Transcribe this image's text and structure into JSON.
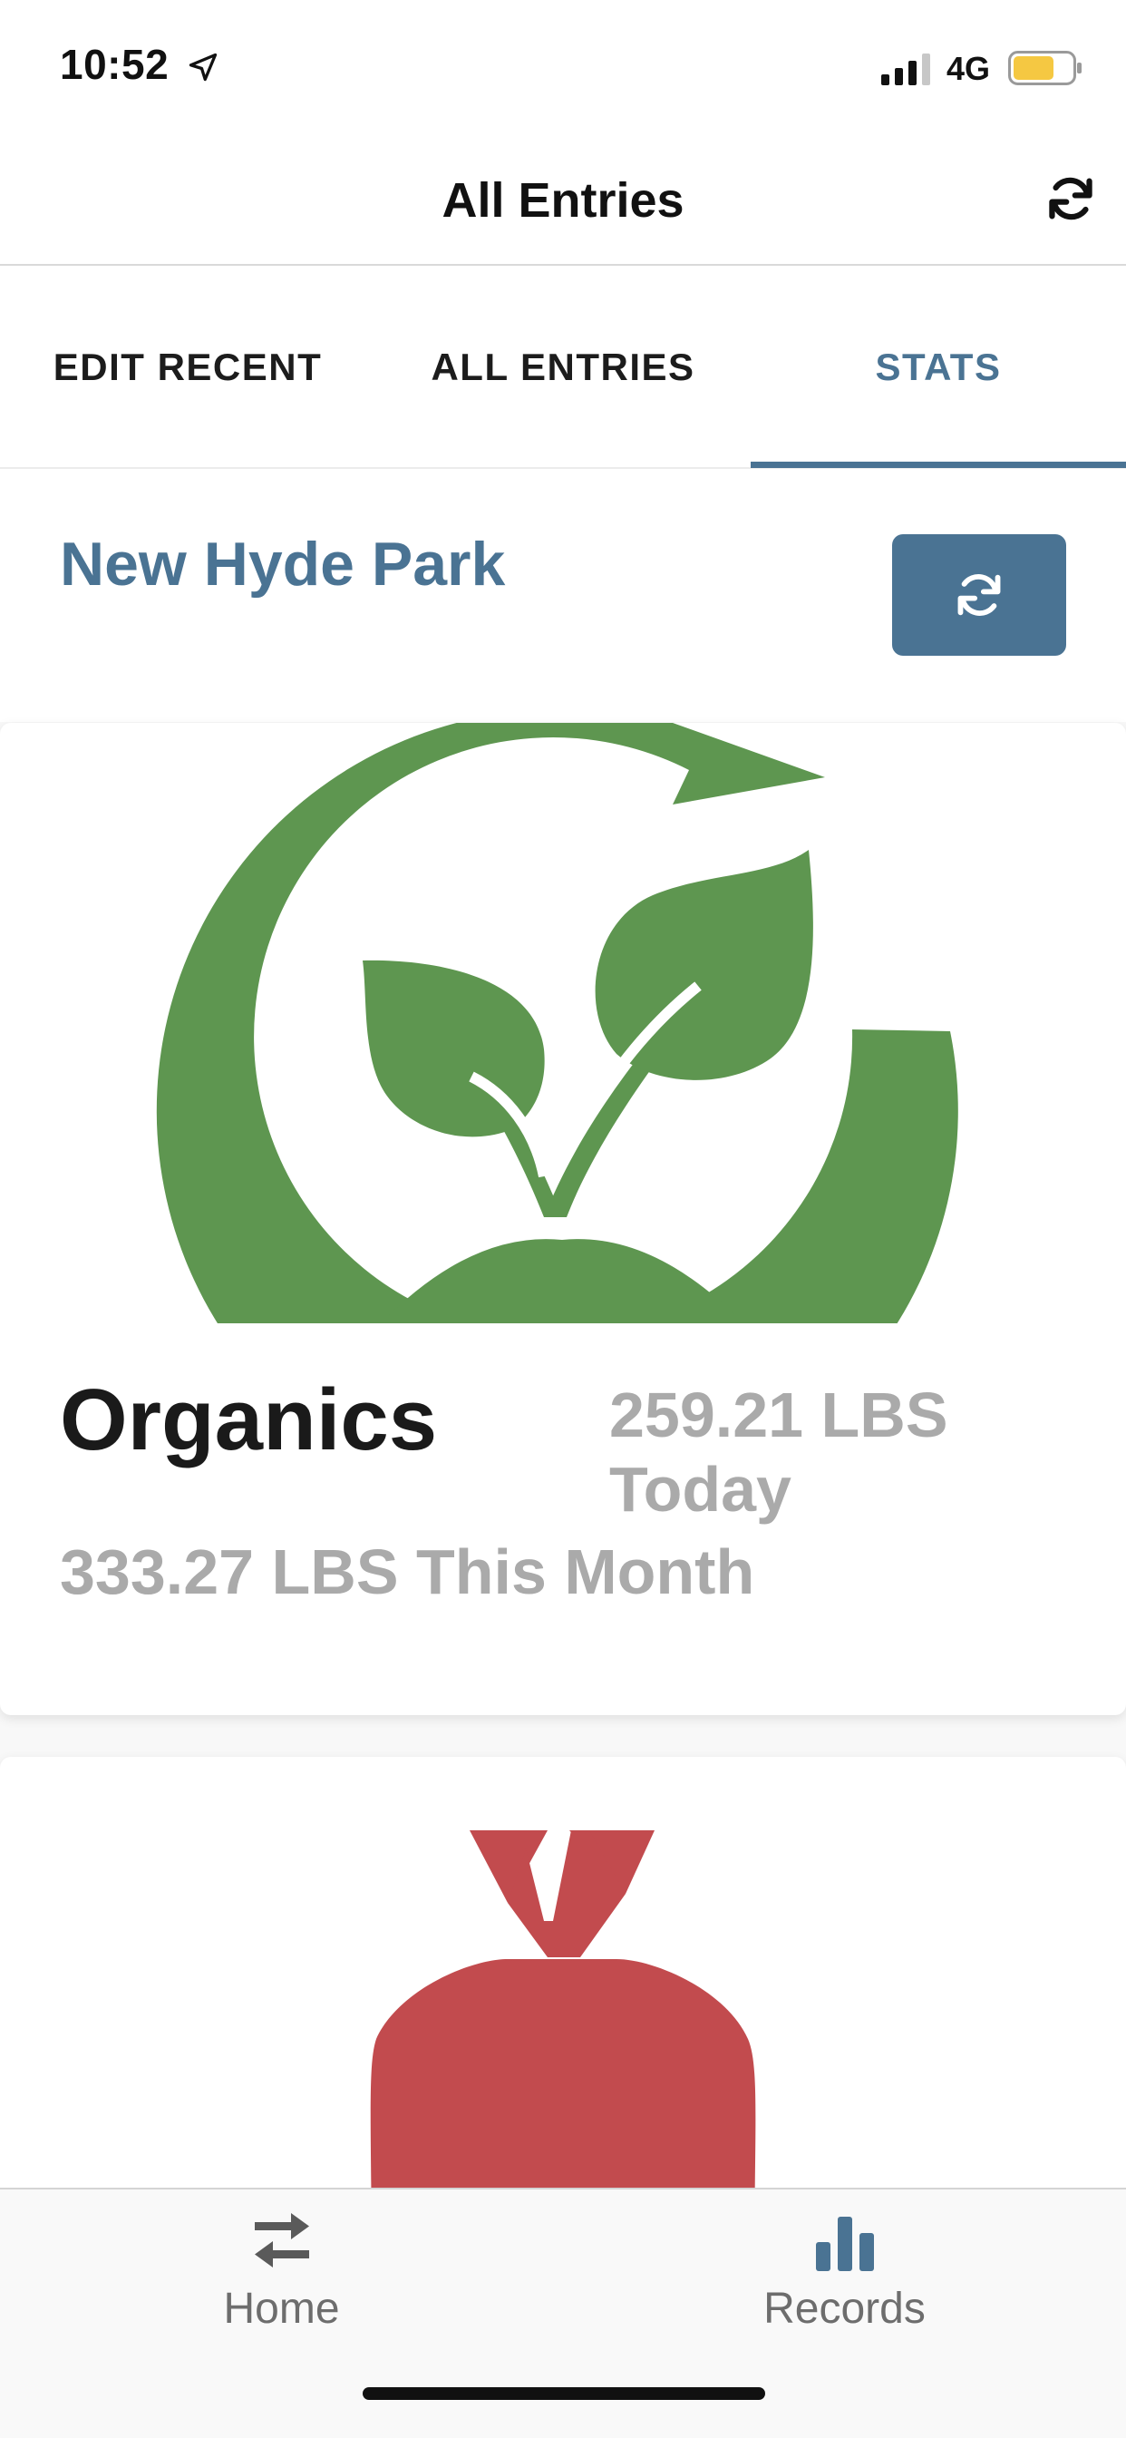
{
  "status_bar": {
    "time": "10:52",
    "network": "4G",
    "location_icon": "location-arrow-icon",
    "signal_icon": "signal-bars-icon",
    "battery_icon": "battery-icon",
    "battery_color": "#f5c842"
  },
  "nav": {
    "title": "All Entries",
    "refresh_icon": "refresh-icon"
  },
  "tabs": {
    "items": [
      {
        "label": "EDIT RECENT"
      },
      {
        "label": "ALL ENTRIES"
      },
      {
        "label": "STATS"
      }
    ],
    "active": "STATS",
    "accent_color": "#4a7393"
  },
  "location": {
    "title": "New Hyde Park",
    "refresh_icon": "refresh-icon"
  },
  "cards": [
    {
      "name": "Organics",
      "today": "259.21 LBS Today",
      "month": "333.27 LBS This Month",
      "icon": "organics-sprout-icon",
      "icon_color": "#5e9650"
    },
    {
      "icon": "trash-bag-icon",
      "icon_color": "#c24b4e"
    }
  ],
  "bottom_tabs": {
    "items": [
      {
        "label": "Home",
        "icon": "swap-arrows-icon"
      },
      {
        "label": "Records",
        "icon": "bar-chart-icon"
      }
    ]
  }
}
